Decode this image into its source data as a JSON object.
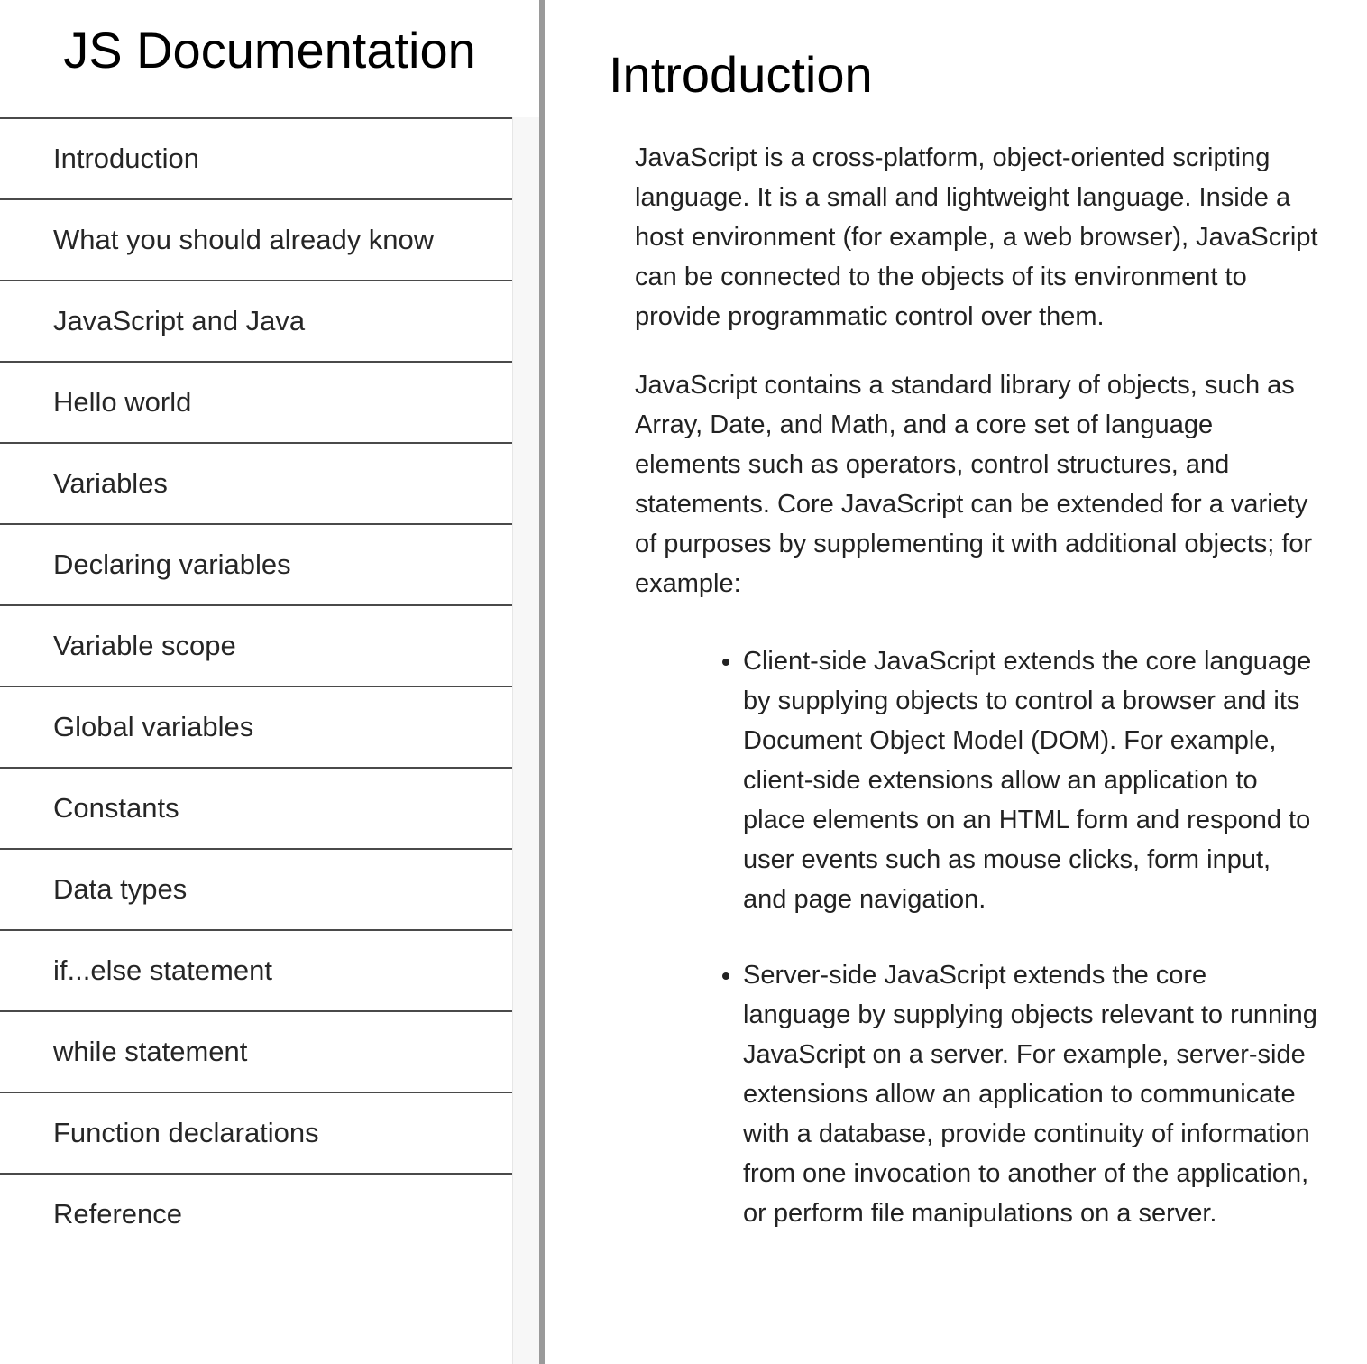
{
  "sidebar": {
    "title": "JS Documentation",
    "items": [
      {
        "label": "Introduction"
      },
      {
        "label": "What you should already know"
      },
      {
        "label": "JavaScript and Java"
      },
      {
        "label": "Hello world"
      },
      {
        "label": "Variables"
      },
      {
        "label": "Declaring variables"
      },
      {
        "label": "Variable scope"
      },
      {
        "label": "Global variables"
      },
      {
        "label": "Constants"
      },
      {
        "label": "Data types"
      },
      {
        "label": "if...else statement"
      },
      {
        "label": "while statement"
      },
      {
        "label": "Function declarations"
      },
      {
        "label": "Reference"
      }
    ]
  },
  "main": {
    "section_title": "Introduction",
    "paragraphs": [
      "JavaScript is a cross-platform, object-oriented scripting language. It is a small and lightweight language. Inside a host environment (for example, a web browser), JavaScript can be connected to the objects of its environment to provide programmatic control over them.",
      "JavaScript contains a standard library of objects, such as Array, Date, and Math, and a core set of language elements such as operators, control structures, and statements. Core JavaScript can be extended for a variety of purposes by supplementing it with additional objects; for example:"
    ],
    "bullets": [
      "Client-side JavaScript extends the core language by supplying objects to control a browser and its Document Object Model (DOM). For example, client-side extensions allow an application to place elements on an HTML form and respond to user events such as mouse clicks, form input, and page navigation.",
      "Server-side JavaScript extends the core language by supplying objects relevant to running JavaScript on a server. For example, server-side extensions allow an application to communicate with a database, provide continuity of information from one invocation to another of the application, or perform file manipulations on a server."
    ]
  }
}
